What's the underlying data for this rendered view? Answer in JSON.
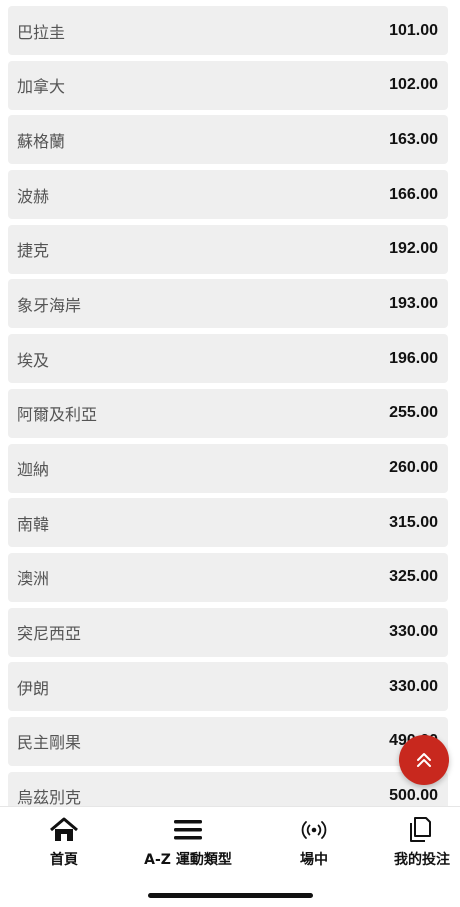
{
  "list": [
    {
      "name": "巴拉圭",
      "odds": "101.00"
    },
    {
      "name": "加拿大",
      "odds": "102.00"
    },
    {
      "name": "蘇格蘭",
      "odds": "163.00"
    },
    {
      "name": "波赫",
      "odds": "166.00"
    },
    {
      "name": "捷克",
      "odds": "192.00"
    },
    {
      "name": "象牙海岸",
      "odds": "193.00"
    },
    {
      "name": "埃及",
      "odds": "196.00"
    },
    {
      "name": "阿爾及利亞",
      "odds": "255.00"
    },
    {
      "name": "迦納",
      "odds": "260.00"
    },
    {
      "name": "南韓",
      "odds": "315.00"
    },
    {
      "name": "澳洲",
      "odds": "325.00"
    },
    {
      "name": "突尼西亞",
      "odds": "330.00"
    },
    {
      "name": "伊朗",
      "odds": "330.00"
    },
    {
      "name": "民主剛果",
      "odds": "490.00"
    },
    {
      "name": "烏茲別克",
      "odds": "500.00"
    }
  ],
  "fab": {
    "icon": "double-chevron-up-icon"
  },
  "tabbar": {
    "home": {
      "label": "首頁",
      "icon": "home-icon"
    },
    "az": {
      "label": "A-Z 運動類型",
      "icon": "menu-icon"
    },
    "live": {
      "label": "場中",
      "icon": "live-broadcast-icon"
    },
    "bets": {
      "label": "我的投注",
      "icon": "copy-icon"
    }
  },
  "colors": {
    "accent": "#c8281e",
    "row_bg": "#efefef"
  }
}
